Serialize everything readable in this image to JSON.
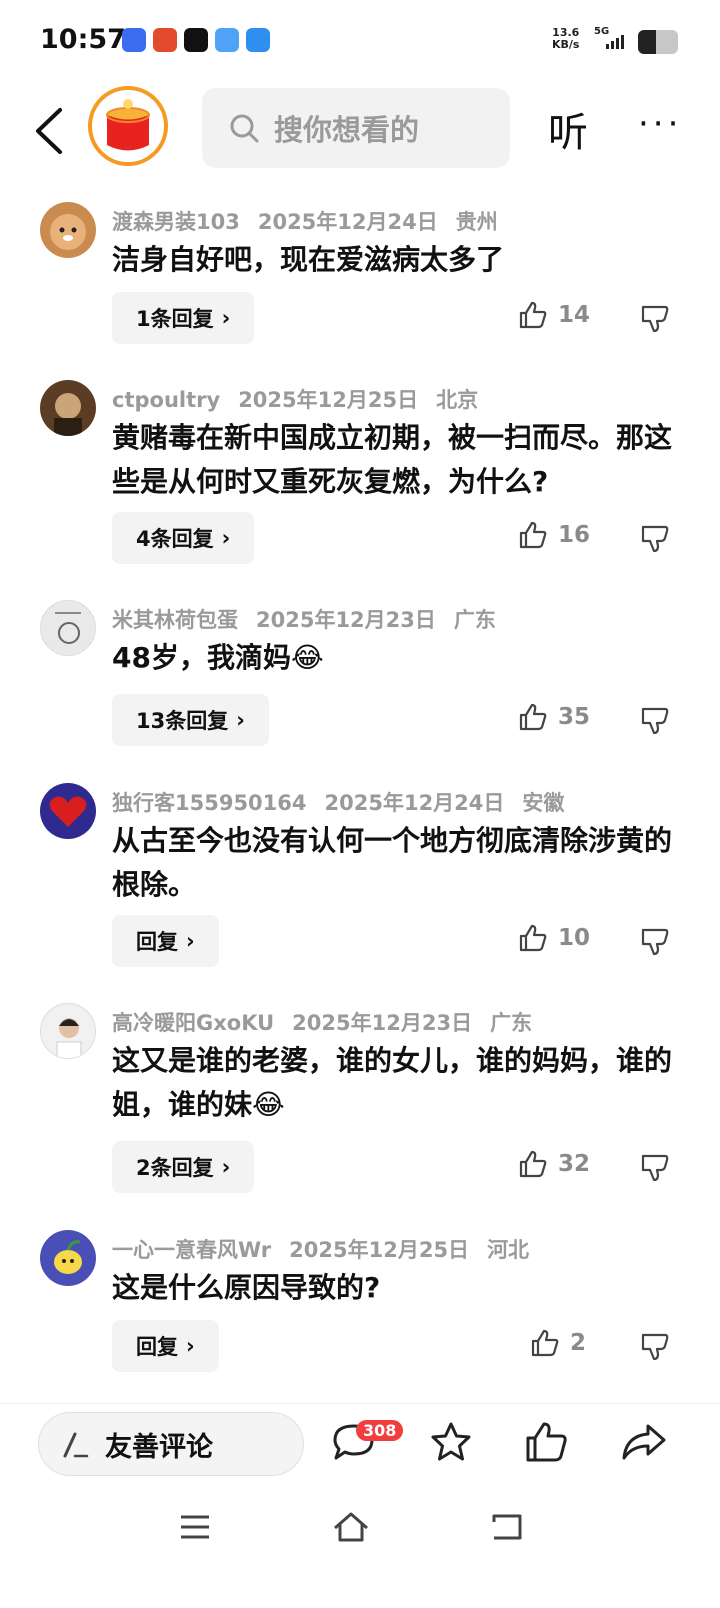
{
  "status_bar": {
    "time": "10:57",
    "net_speed_value": "13.6",
    "net_speed_unit": "KB/s",
    "signal_type": "5G",
    "battery_level_fraction": 0.45
  },
  "header": {
    "search_placeholder": "搜你想看的",
    "listen_label": "听",
    "more_label": "···"
  },
  "comments": [
    {
      "user": "渡森男装103",
      "date": "2025年12月24日",
      "location": "贵州",
      "text": "洁身自好吧，现在爱滋病太多了",
      "replies": "1条回复",
      "likes": "14",
      "avatar_color": "#c98b4f"
    },
    {
      "user": "ctpoultry",
      "date": "2025年12月25日",
      "location": "北京",
      "text": "黄赌毒在新中国成立初期，被一扫而尽。那这些是从何时又重死灰复燃，为什么?",
      "replies": "4条回复",
      "likes": "16",
      "avatar_color": "#5a3d24"
    },
    {
      "user": "米其林荷包蛋",
      "date": "2025年12月23日",
      "location": "广东",
      "text": "48岁，我滴妈😂",
      "replies": "13条回复",
      "likes": "35",
      "avatar_color": "#e9e9e9"
    },
    {
      "user": "独行客155950164",
      "date": "2025年12月24日",
      "location": "安徽",
      "text": "从古至今也没有认何一个地方彻底清除涉黄的根除。",
      "replies": "回复",
      "likes": "10",
      "avatar_color": "#2e2a8f"
    },
    {
      "user": "高冷暖阳GxoKU",
      "date": "2025年12月23日",
      "location": "广东",
      "text": "这又是谁的老婆，谁的女儿，谁的妈妈，谁的姐，谁的妹😂",
      "replies": "2条回复",
      "likes": "32",
      "avatar_color": "#f1f1f1"
    },
    {
      "user": "一心一意春风Wr",
      "date": "2025年12月25日",
      "location": "河北",
      "text": "这是什么原因导致的?",
      "replies": "回复",
      "likes": "2",
      "avatar_color": "#4a4fb8"
    }
  ],
  "bottom_bar": {
    "comment_input_label": "友善评论",
    "comment_count_badge": "308"
  },
  "colors": {
    "accent_orange": "#f59a23",
    "badge_red": "#f23d3d",
    "muted_text": "#9a9a9a"
  }
}
